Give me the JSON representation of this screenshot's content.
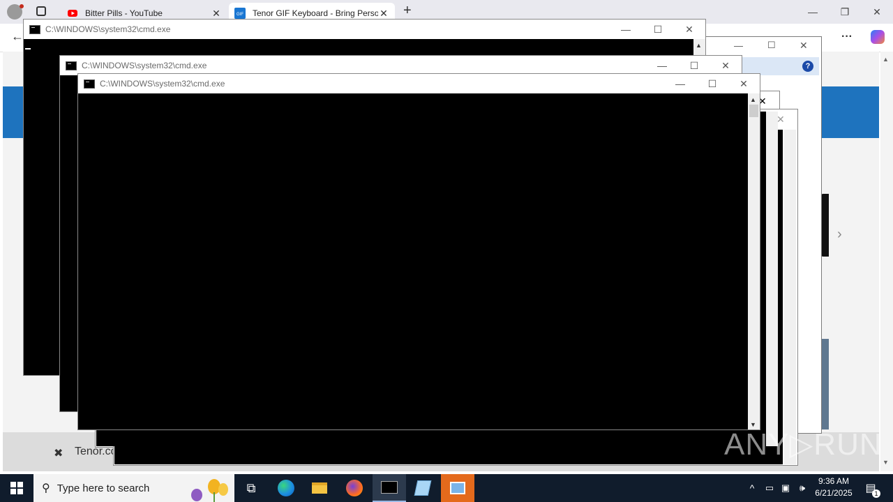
{
  "browser": {
    "tabs": [
      {
        "title": "Bitter Pills - YouTube",
        "close": "✕"
      },
      {
        "title": "Tenor GIF Keyboard - Bring Perso",
        "close": "✕"
      }
    ],
    "new_tab": "+",
    "win_min": "—",
    "win_restore": "❐",
    "win_close": "✕",
    "back": "←",
    "more": "···"
  },
  "page": {
    "footer_close": "✖",
    "footer_text": "Tenor.co",
    "chevron": "›"
  },
  "dialog": {
    "help": "?"
  },
  "cmd_windows": [
    {
      "title": "C:\\WINDOWS\\system32\\cmd.exe"
    },
    {
      "title": "C:\\WINDOWS\\system32\\cmd.exe"
    },
    {
      "title": "C:\\WINDOWS\\system32\\cmd.exe"
    }
  ],
  "cmd_controls": {
    "min": "—",
    "max": "☐",
    "close": "✕"
  },
  "watermark": "ANY▷RUN",
  "taskbar": {
    "search_placeholder": "Type here to search",
    "time": "9:36 AM",
    "date": "6/21/2025",
    "notification_count": "1",
    "tray_chevron": "^"
  },
  "colors": {
    "taskbar": "#101c2c",
    "page_blue": "#1e73be",
    "anyrun_accent": "#e46a1c"
  }
}
